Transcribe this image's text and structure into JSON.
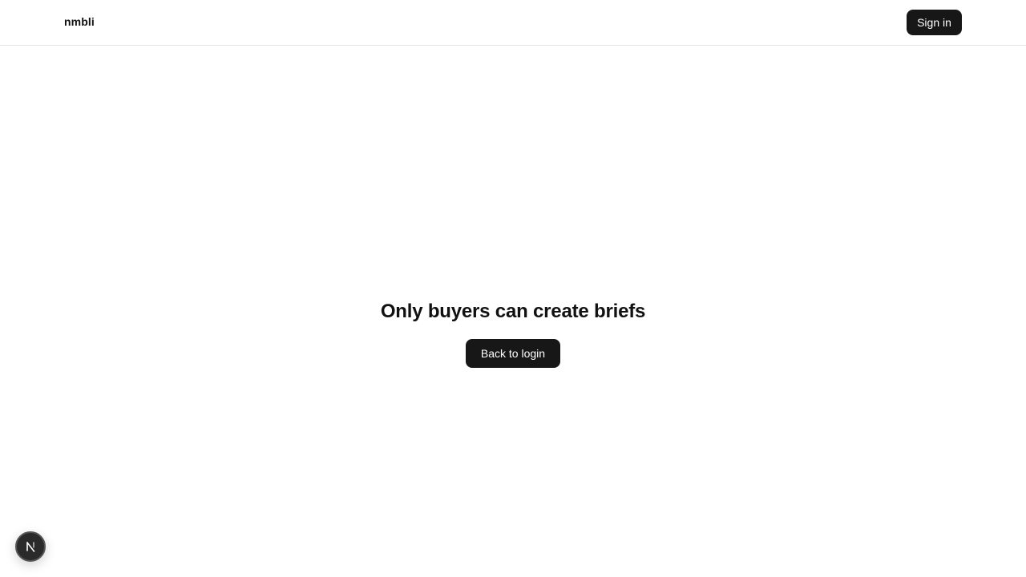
{
  "header": {
    "brand": "nmbli",
    "sign_in_label": "Sign in"
  },
  "main": {
    "headline": "Only buyers can create briefs",
    "back_label": "Back to login"
  },
  "dev_badge": {
    "icon": "nextjs-logo-icon"
  },
  "colors": {
    "button_bg": "#171717",
    "text": "#111111",
    "divider": "#e5e5e5"
  }
}
